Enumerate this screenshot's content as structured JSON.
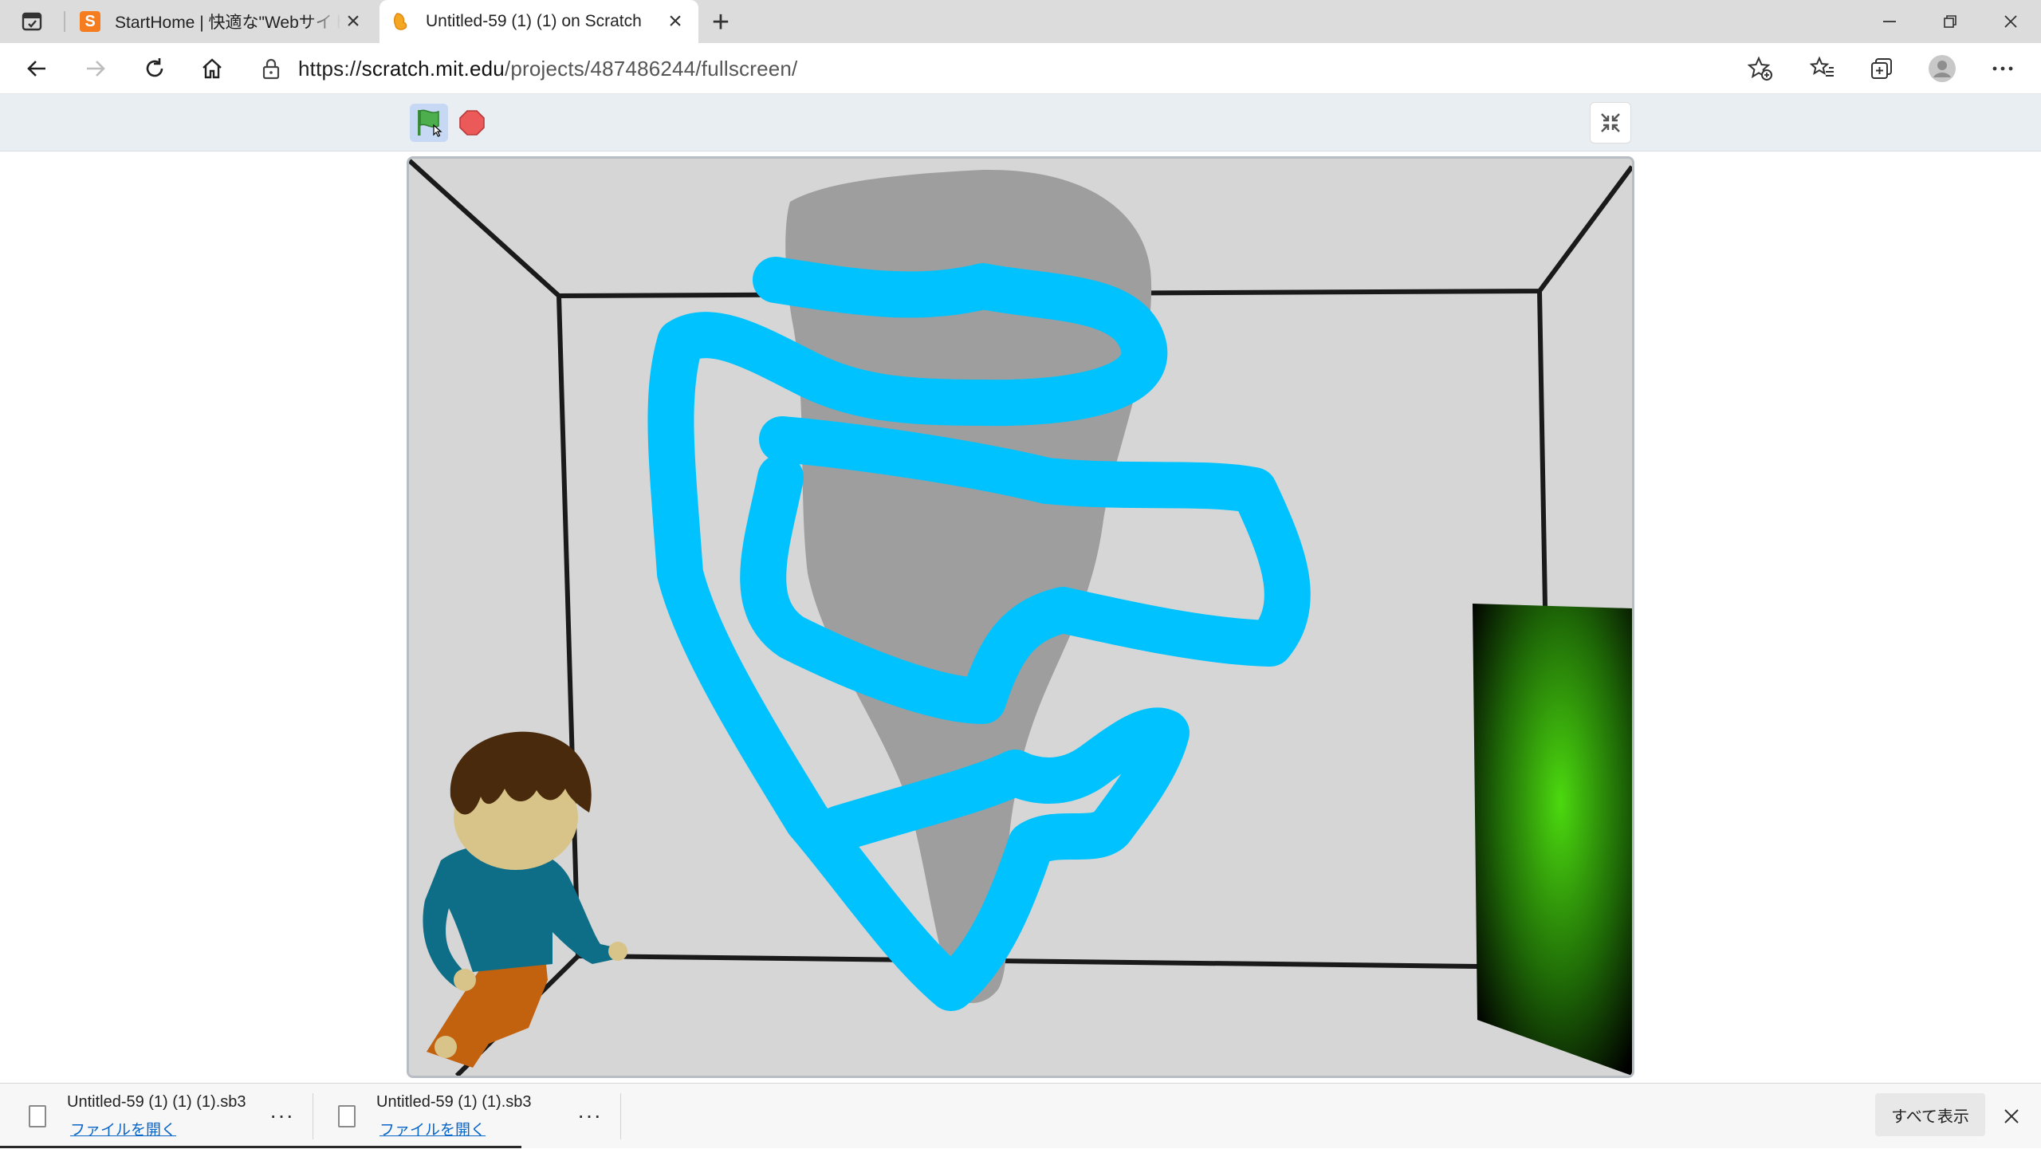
{
  "browser": {
    "tabs": [
      {
        "title": "StartHome | 快適な\"Webサイトの入",
        "favicon_letter": "S",
        "favicon_color": "#f57c1f"
      },
      {
        "title": "Untitled-59 (1) (1) on Scratch",
        "favicon_color": "#f5a623",
        "active": true
      }
    ],
    "new_tab_symbol": "+",
    "url": {
      "scheme": "https://",
      "host": "scratch.mit.edu",
      "path": "/projects/487486244/fullscreen/"
    },
    "window_controls": [
      "minimize",
      "restore",
      "close"
    ]
  },
  "player": {
    "green_flag_color": "#4cae4c",
    "stop_color": "#ec5959",
    "stage_colors": {
      "background": "#d6d6d6",
      "room_lines": "#1a1a1a",
      "gray_shape": "#9e9e9e",
      "blue_scribble": "#00c2ff",
      "portal_green": "#4cd90f",
      "shirt": "#0e6e88",
      "pants": "#c3620e",
      "hair": "#4a2a0c",
      "skin": "#d8c489"
    }
  },
  "downloads": {
    "items": [
      {
        "filename": "Untitled-59 (1) (1) (1).sb3",
        "action": "ファイルを開く"
      },
      {
        "filename": "Untitled-59 (1) (1).sb3",
        "action": "ファイルを開く"
      }
    ],
    "more_symbol": "···",
    "show_all_label": "すべて表示"
  }
}
